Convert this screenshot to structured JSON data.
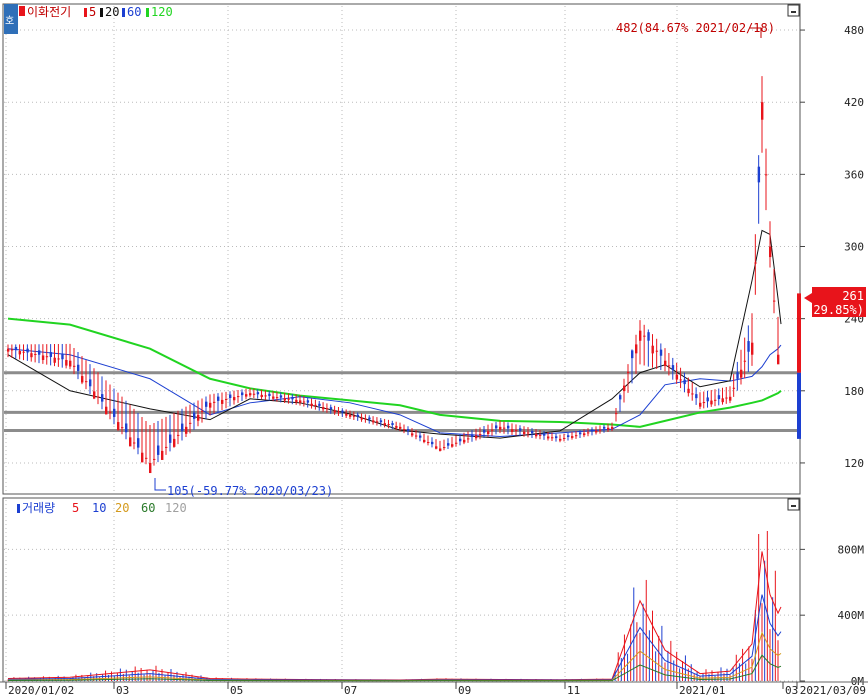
{
  "price_panel": {
    "legend": {
      "name": "이화전기",
      "ma": [
        "5",
        "20",
        "60",
        "120"
      ]
    },
    "y_ticks": [
      120,
      180,
      240,
      300,
      360,
      420,
      480
    ],
    "current_price": "261",
    "current_change": "( 29.85%)",
    "high_annotation": "482(84.67% 2021/02/18)",
    "low_annotation": "105(-59.77% 2020/03/23)",
    "button_label": "호"
  },
  "volume_panel": {
    "legend": {
      "name": "거래량",
      "ma": [
        "5",
        "10",
        "20",
        "60",
        "120"
      ]
    },
    "y_ticks": [
      "0M",
      "400M",
      "800M"
    ]
  },
  "x_ticks": [
    "2020/01/02",
    "03",
    "05",
    "07",
    "09",
    "11",
    "2021/01",
    "03",
    "2021/03/09"
  ],
  "colors": {
    "up": "#e8141b",
    "down": "#1c3fd1",
    "ma5": "#e8141b",
    "ma20": "#111111",
    "ma60": "#1c3fd1",
    "ma120": "#21d421",
    "vma20": "#d49a1c",
    "vma60": "#2a7a2a",
    "vma120": "#a0a0a0"
  },
  "chart_data": [
    {
      "type": "candlestick",
      "ylim": [
        95,
        500
      ],
      "horizontal_lines": [
        195,
        162,
        147
      ],
      "x": [
        "2020/01",
        "2020/02",
        "2020/03",
        "2020/04",
        "2020/05",
        "2020/06",
        "2020/07",
        "2020/08",
        "2020/09",
        "2020/10",
        "2020/11",
        "2020/12",
        "2020/12/10",
        "2020/12/20",
        "2021/01",
        "2021/02/01",
        "2021/02/10",
        "2021/02/18",
        "2021/02/25",
        "2021/03/02",
        "2021/03/09"
      ],
      "close": [
        215,
        205,
        120,
        170,
        178,
        172,
        160,
        150,
        132,
        150,
        140,
        150,
        230,
        205,
        170,
        175,
        220,
        420,
        300,
        210,
        261
      ],
      "high": [
        225,
        245,
        210,
        190,
        190,
        185,
        170,
        160,
        150,
        165,
        150,
        160,
        255,
        235,
        195,
        200,
        290,
        482,
        360,
        300,
        265
      ],
      "low": [
        195,
        185,
        105,
        140,
        168,
        160,
        150,
        140,
        125,
        135,
        132,
        140,
        150,
        180,
        155,
        160,
        165,
        300,
        250,
        200,
        140
      ],
      "ma120": [
        240,
        235,
        215,
        190,
        182,
        176,
        172,
        168,
        160,
        155,
        154,
        152,
        150,
        155,
        162,
        166,
        170,
        172,
        175,
        178,
        180
      ],
      "ma60": [
        215,
        210,
        190,
        160,
        170,
        175,
        170,
        160,
        145,
        142,
        145,
        148,
        160,
        185,
        190,
        188,
        192,
        200,
        210,
        215,
        218
      ]
    },
    {
      "type": "bar",
      "ylabel": "",
      "ylim_millions": [
        0,
        1100
      ],
      "x": [
        "2020/01",
        "2020/02",
        "2020/03",
        "2020/04",
        "2020/05",
        "2020/06",
        "2020/07",
        "2020/08",
        "2020/09",
        "2020/10",
        "2020/11",
        "2020/12",
        "2020/12/10",
        "2020/12/20",
        "2021/01",
        "2021/02/01",
        "2021/02/10",
        "2021/02/18",
        "2021/02/25",
        "2021/03/02",
        "2021/03/09"
      ],
      "volume_millions": [
        20,
        30,
        90,
        20,
        15,
        12,
        10,
        8,
        15,
        12,
        10,
        15,
        650,
        250,
        60,
        80,
        300,
        1050,
        700,
        550,
        600
      ]
    }
  ]
}
